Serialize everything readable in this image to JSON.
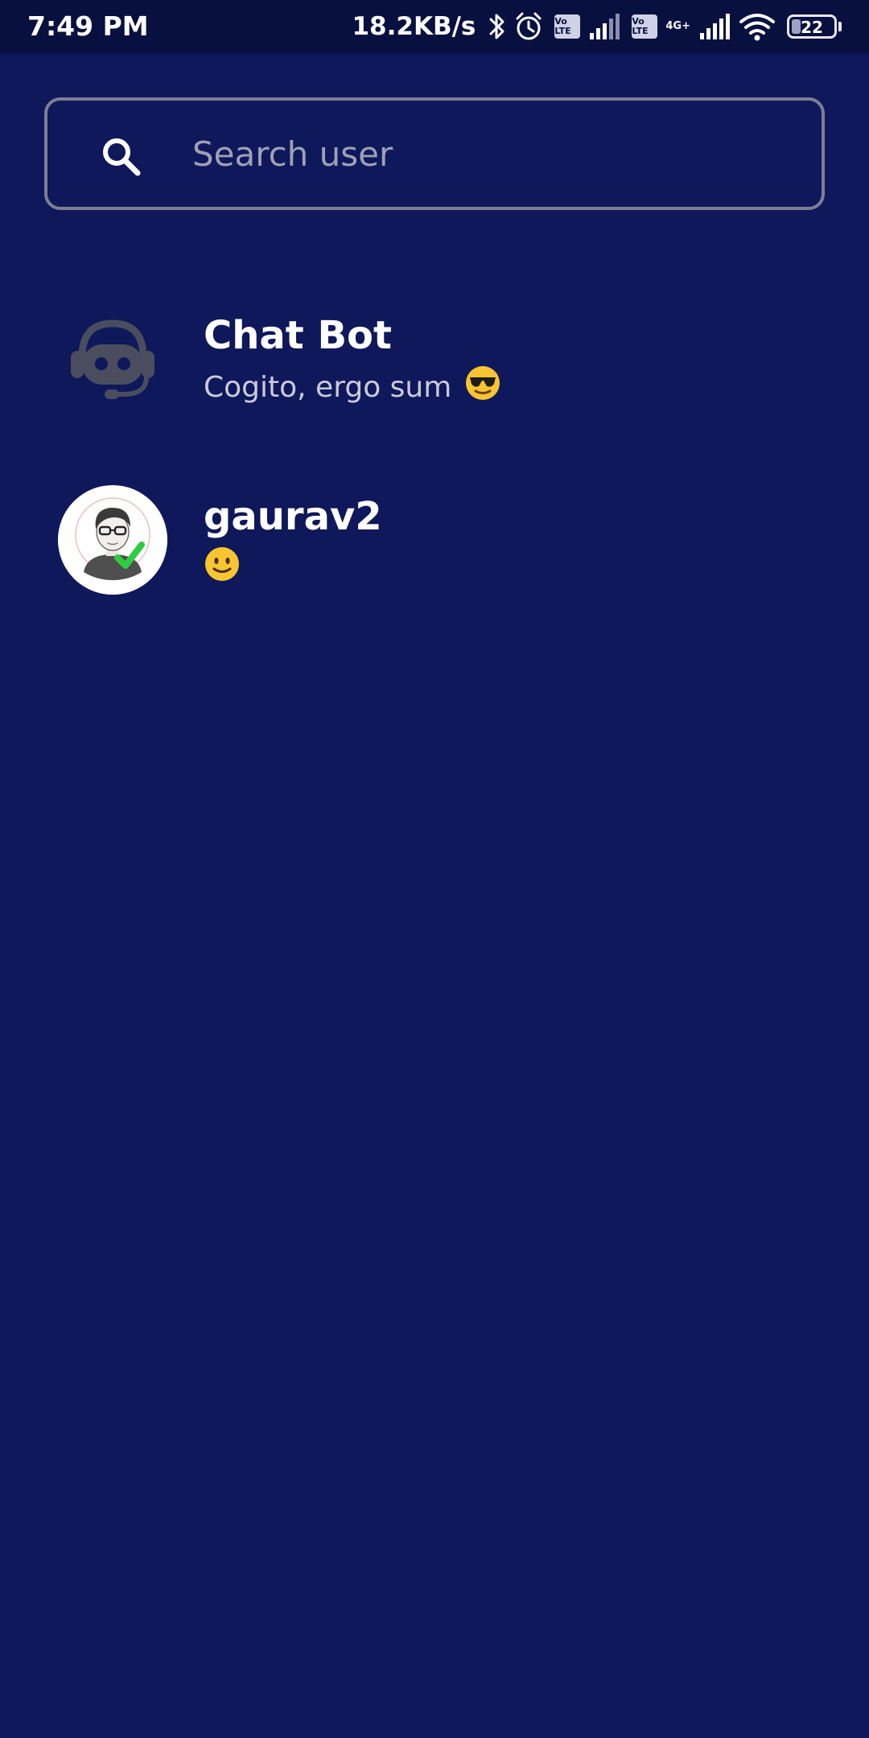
{
  "status_bar": {
    "time": "7:49 PM",
    "net_speed": "18.2KB/s",
    "lte_badge_1": "Vo LTE",
    "lte_badge_2": "Vo LTE",
    "network_generation": "4G+",
    "battery_level": "22",
    "battery_fraction": 0.22,
    "icons": [
      "bluetooth-icon",
      "alarm-icon",
      "signal-icon",
      "signal-icon",
      "wifi-icon",
      "battery-icon"
    ]
  },
  "search": {
    "placeholder": "Search user",
    "value": "",
    "icon": "search-icon"
  },
  "chats": [
    {
      "name": "Chat Bot",
      "status": "Cogito, ergo sum",
      "status_emoji": "sunglasses-face",
      "avatar": "bot-headset-icon"
    },
    {
      "name": "gaurav2",
      "status": "",
      "status_emoji": "slightly-smiling-face",
      "avatar": "user-avatar-verified"
    }
  ],
  "colors": {
    "background": "#0e185a",
    "status_bar": "#08103f",
    "search_border": "#7c7f93",
    "placeholder": "#9ea0b6",
    "secondary_text": "#c9cbdb",
    "bot_icon": "#4a4d5e",
    "verified_check": "#2ecc40"
  }
}
